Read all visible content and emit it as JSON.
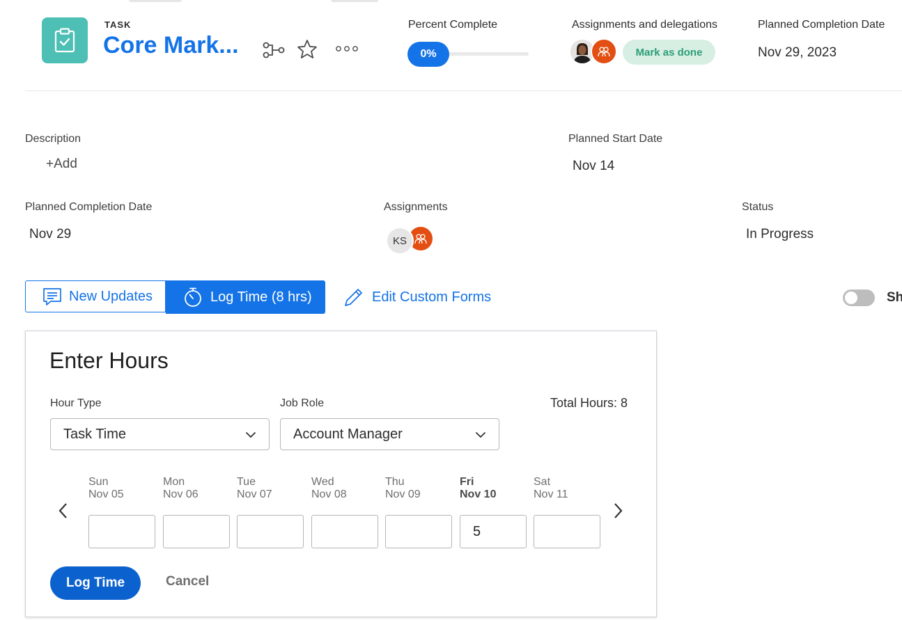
{
  "header": {
    "type_label": "TASK",
    "title": "Core Mark...",
    "percent_complete": {
      "label": "Percent Complete",
      "value_text": "0%",
      "value": 0
    },
    "assignments": {
      "label": "Assignments and delegations",
      "mark_done": "Mark as done"
    },
    "planned_completion": {
      "label": "Planned Completion Date",
      "value": "Nov 29, 2023"
    }
  },
  "details": {
    "description": {
      "label": "Description",
      "add": "+Add"
    },
    "planned_start": {
      "label": "Planned Start Date",
      "value": "Nov 14"
    },
    "planned_completion": {
      "label": "Planned Completion Date",
      "value": "Nov 29"
    },
    "assignments": {
      "label": "Assignments",
      "initials": "KS"
    },
    "status": {
      "label": "Status",
      "value": "In Progress"
    }
  },
  "tabs": {
    "updates": "New Updates",
    "log_time": "Log Time (8 hrs)",
    "edit_forms": "Edit Custom Forms",
    "toggle_label": "Sh"
  },
  "panel": {
    "title": "Enter Hours",
    "hour_type": {
      "label": "Hour Type",
      "value": "Task Time"
    },
    "job_role": {
      "label": "Job Role",
      "value": "Account Manager"
    },
    "total": "Total Hours: 8",
    "days": [
      {
        "name": "Sun",
        "date": "Nov 05",
        "value": ""
      },
      {
        "name": "Mon",
        "date": "Nov 06",
        "value": ""
      },
      {
        "name": "Tue",
        "date": "Nov 07",
        "value": ""
      },
      {
        "name": "Wed",
        "date": "Nov 08",
        "value": ""
      },
      {
        "name": "Thu",
        "date": "Nov 09",
        "value": ""
      },
      {
        "name": "Fri",
        "date": "Nov 10",
        "value": "5"
      },
      {
        "name": "Sat",
        "date": "Nov 11",
        "value": ""
      }
    ],
    "log_button": "Log Time",
    "cancel_button": "Cancel"
  },
  "colors": {
    "accent": "#1473e6",
    "task_icon": "#4dbfb5",
    "team_avatar": "#e34f12",
    "done_bg": "#d7efe2",
    "done_text": "#2d9d78"
  }
}
